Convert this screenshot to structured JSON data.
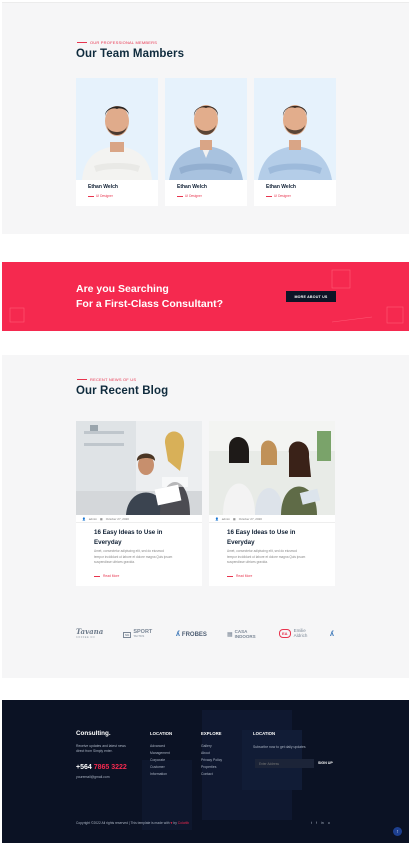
{
  "team": {
    "eyebrow": "OUR PROFESSIONAL MEMBERS",
    "title": "Our Team Mambers",
    "members": [
      {
        "name": "Ethan Welch",
        "role": "UI Designer"
      },
      {
        "name": "Ethan Welch",
        "role": "UI Designer"
      },
      {
        "name": "Ethan Welch",
        "role": "UI Designer"
      }
    ]
  },
  "cta": {
    "line1": "Are you Searching",
    "line2": "For a First-Class Consultant?",
    "button": "MORE ABOUT US"
  },
  "blog": {
    "eyebrow": "RECENT NEWS OF US",
    "title": "Our Recent Blog",
    "posts": [
      {
        "author": "admin",
        "date": "October 27, 2020",
        "title_line1": "16 Easy Ideas to Use in",
        "title_line2": "Everyday",
        "excerpt_l1": "Amet, consectetur adipiscing elit, sed do eiusmod",
        "excerpt_l2": "tempor incididunt ut labore et dolore magna Quis ipsum",
        "excerpt_l3": "suspendisse ultrices gravida.",
        "read_more": "Read More"
      },
      {
        "author": "admin",
        "date": "October 27, 2020",
        "title_line1": "16 Easy Ideas to Use in",
        "title_line2": "Everyday",
        "excerpt_l1": "Amet, consectetur adipiscing elit, sed do eiusmod",
        "excerpt_l2": "tempor incididunt ut labore et dolore magna Quis ipsum",
        "excerpt_l3": "suspendisse ultrices gravida.",
        "read_more": "Read More"
      }
    ]
  },
  "logos": {
    "tavana": "Tavana",
    "tavana_sub": "COFFEE CO",
    "sport": "SPORT",
    "sport_sub": "TACTICS",
    "frobes": "FROBES",
    "casa1": "CASA",
    "casa2": "INDOORS",
    "emilie1": "Emilie",
    "emilie2": "Aldrich"
  },
  "footer": {
    "brand": "Consulting.",
    "about_l1": "Receive updates and latest news",
    "about_l2": "direct from Simply enter.",
    "phone_prefix": "+564",
    "phone_rest": "7865 3222",
    "email": "youremail@gmail.com",
    "col1_head": "LOCATION",
    "col1_links": [
      "Advanced",
      "Management",
      "Corporate",
      "Customer",
      "Information"
    ],
    "col2_head": "EXPLORE",
    "col2_links": [
      "Gallery",
      "About",
      "Privacy Policy",
      "Properties",
      "Contact"
    ],
    "col3_head": "LOCATION",
    "subscribe_text": "Subscribe now to get daily updates",
    "email_placeholder": "Enter Address",
    "signup": "SIGN UP",
    "copyright_text": "Copyright ©2022 All rights reserved | This template is made with",
    "copyright_by": "by",
    "copyright_author": "Colorlib",
    "social": [
      "t",
      "f",
      "in",
      "o"
    ],
    "scroll_top": "↑"
  },
  "colors": {
    "accent": "#f5294f",
    "dark": "#0b1224",
    "heading": "#0f2b3d"
  }
}
